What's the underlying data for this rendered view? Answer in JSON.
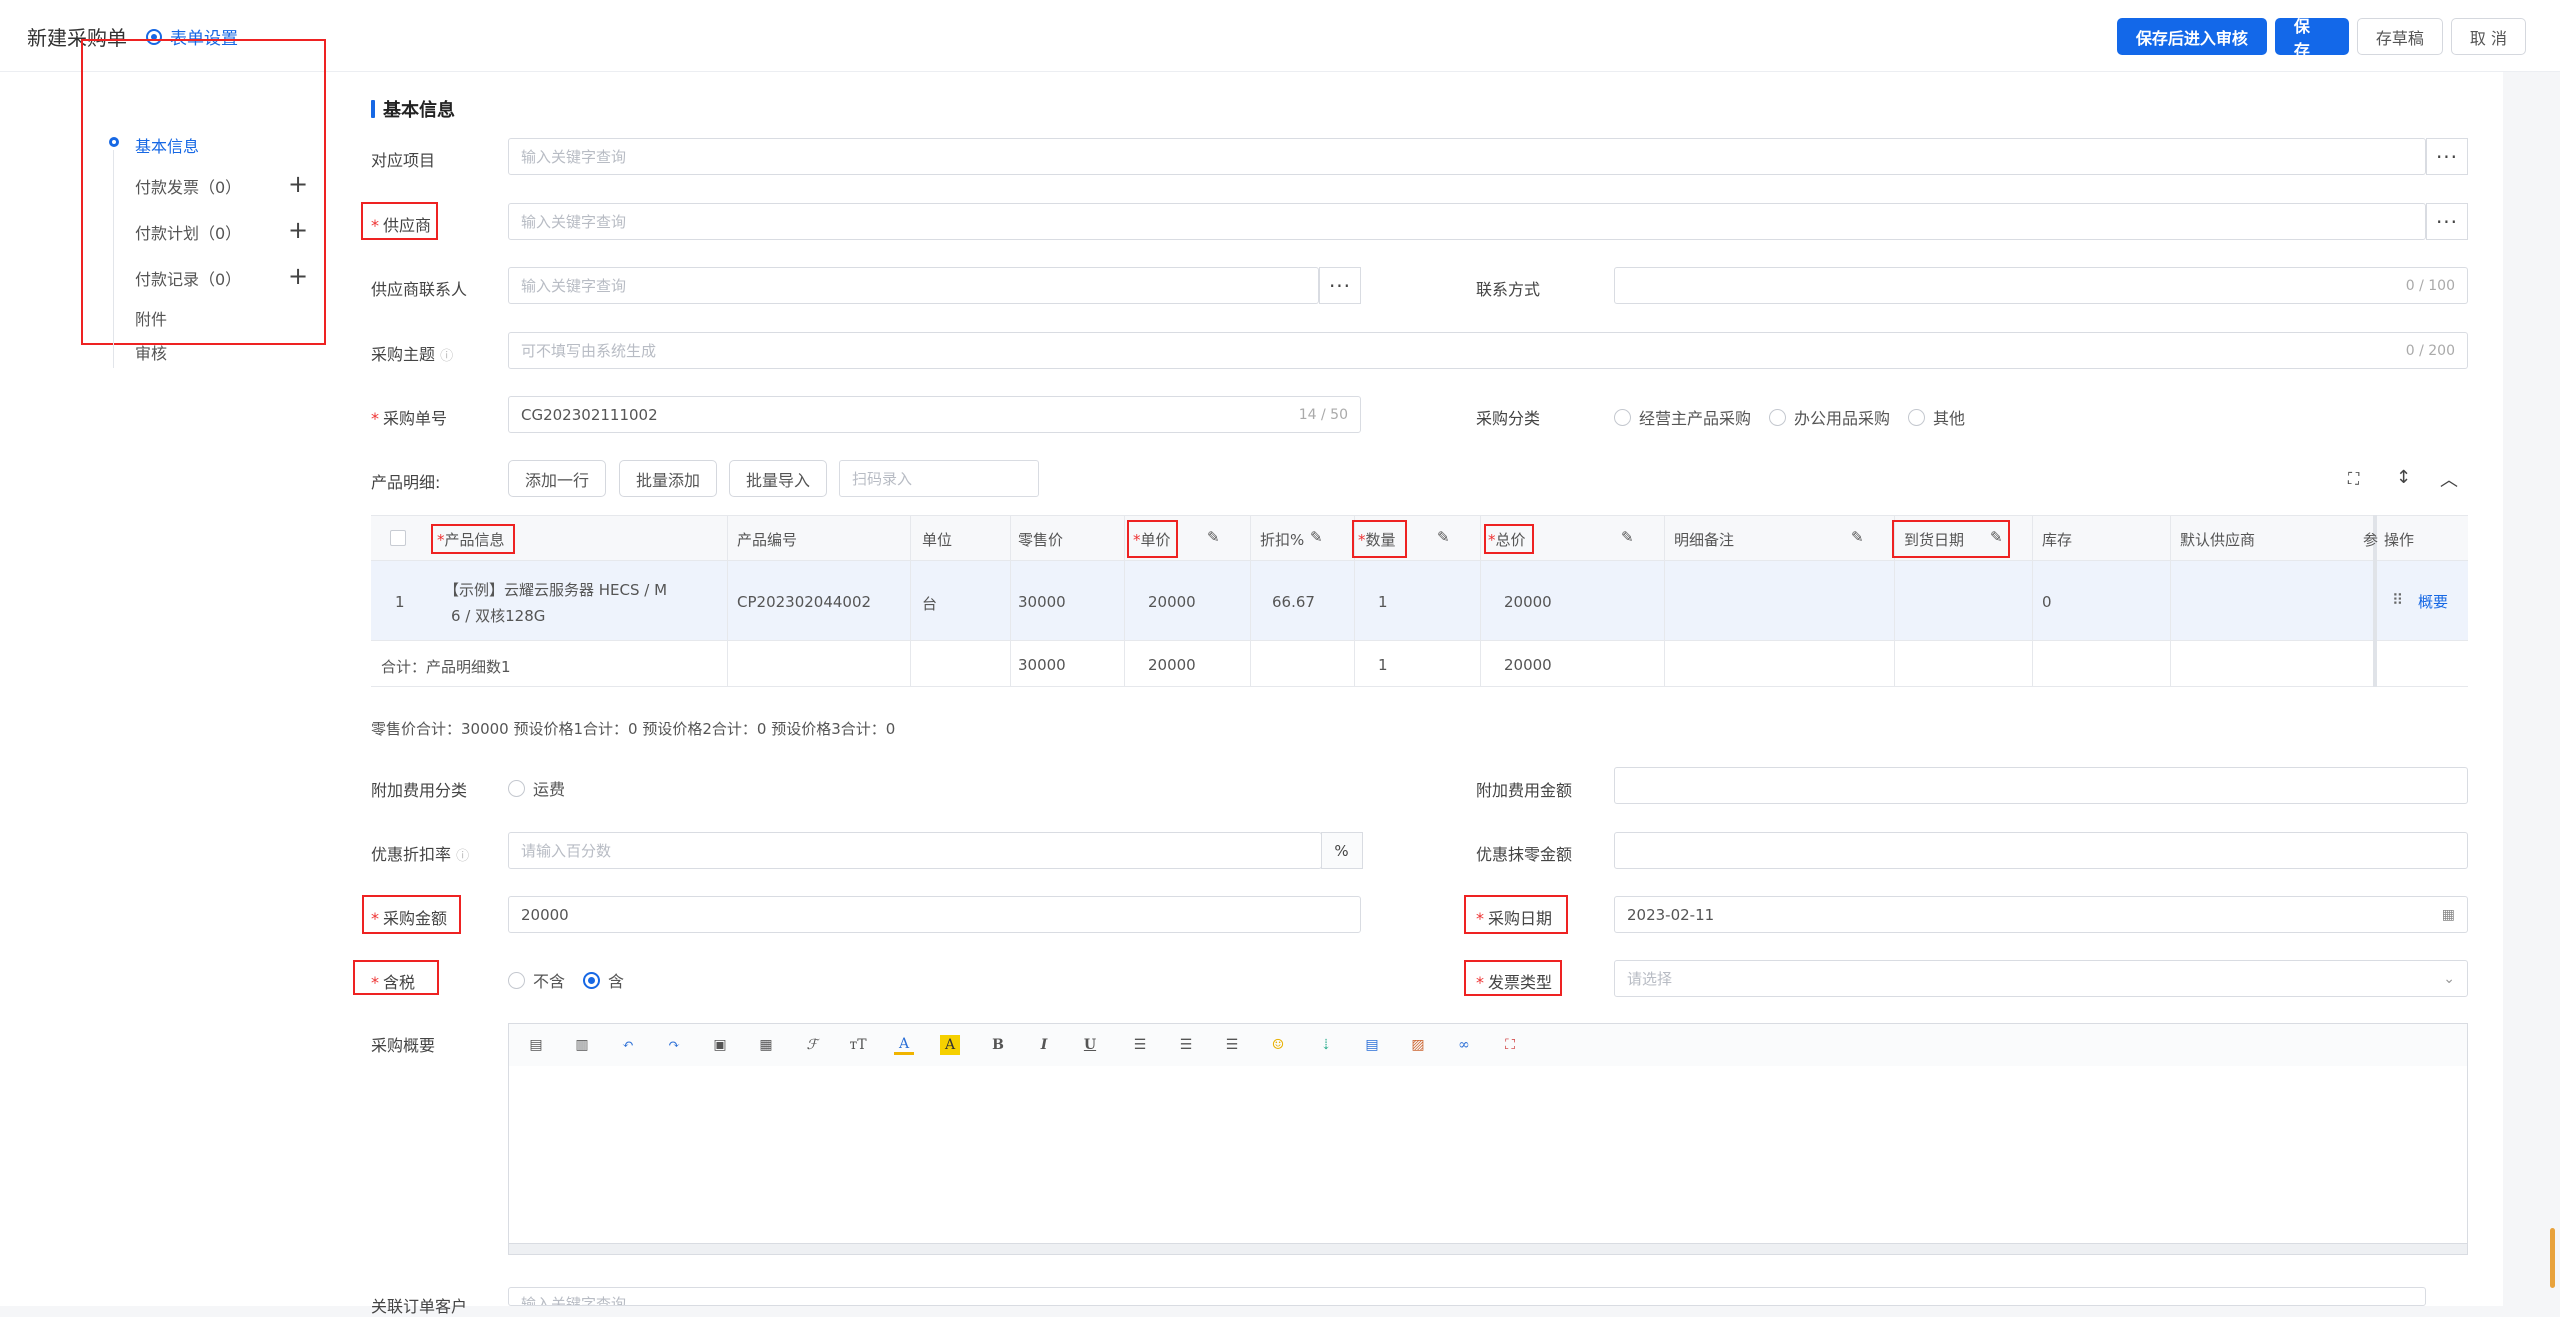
{
  "header": {
    "title": "新建采购单",
    "form_settings": "表单设置",
    "buttons": {
      "save_submit": "保存后进入审核",
      "save": "保 存",
      "draft": "存草稿",
      "cancel": "取 消"
    }
  },
  "nav": {
    "items": [
      {
        "label": "基本信息",
        "active": true
      },
      {
        "label": "付款发票（0）"
      },
      {
        "label": "付款计划（0）"
      },
      {
        "label": "付款记录（0）"
      },
      {
        "label": "附件"
      },
      {
        "label": "审核"
      }
    ],
    "plus": "+"
  },
  "section": {
    "title": "基本信息"
  },
  "fields": {
    "project": {
      "label": "对应项目",
      "placeholder": "输入关键字查询"
    },
    "supplier": {
      "label": "供应商",
      "placeholder": "输入关键字查询"
    },
    "supplier_contact": {
      "label": "供应商联系人",
      "placeholder": "输入关键字查询"
    },
    "contact_method": {
      "label": "联系方式",
      "count": "0 / 100"
    },
    "subject": {
      "label": "采购主题",
      "placeholder": "可不填写由系统生成",
      "count": "0 / 200"
    },
    "order_no": {
      "label": "采购单号",
      "value": "CG202302111002",
      "count": "14 / 50"
    },
    "category": {
      "label": "采购分类",
      "options": [
        "经营主产品采购",
        "办公用品采购",
        "其他"
      ]
    },
    "products_label": "产品明细:",
    "product_buttons": {
      "add_row": "添加一行",
      "batch_add": "批量添加",
      "batch_import": "批量导入"
    },
    "scan_placeholder": "扫码录入",
    "extra_fee_type": {
      "label": "附加费用分类",
      "option": "运费"
    },
    "extra_fee_amount": {
      "label": "附加费用金额"
    },
    "discount_rate": {
      "label": "优惠折扣率",
      "placeholder": "请输入百分数",
      "suffix": "%"
    },
    "round_off": {
      "label": "优惠抹零金额"
    },
    "amount": {
      "label": "采购金额",
      "value": "20000"
    },
    "date": {
      "label": "采购日期",
      "value": "2023-02-11"
    },
    "tax": {
      "label": "含税",
      "options": [
        "不含",
        "含"
      ],
      "selected": "含"
    },
    "invoice_type": {
      "label": "发票类型",
      "placeholder": "请选择"
    },
    "summary": {
      "label": "采购概要"
    },
    "related": {
      "label": "关联订单客户",
      "placeholder": "输入关键字查询"
    }
  },
  "table": {
    "headers": {
      "product_info": "产品信息",
      "product_code": "产品编号",
      "unit": "单位",
      "retail": "零售价",
      "price": "单价",
      "discount": "折扣%",
      "qty": "数量",
      "total": "总价",
      "remark": "明细备注",
      "arrival": "到货日期",
      "stock": "库存",
      "default_supplier": "默认供应商",
      "extra": "参",
      "ops": "操作"
    },
    "row": {
      "index": "1",
      "product_info_1": "【示例】云耀云服务器 HECS / M",
      "product_info_2": "6 / 双核128G",
      "product_code": "CP202302044002",
      "unit": "台",
      "retail": "30000",
      "price": "20000",
      "discount": "66.67",
      "qty": "1",
      "total": "20000",
      "stock": "0",
      "op": "概要"
    },
    "sum_row": {
      "label": "合计：产品明细数1",
      "retail": "30000",
      "price": "20000",
      "qty": "1",
      "total": "20000"
    },
    "totals_line": "零售价合计：30000  预设价格1合计：0  预设价格2合计：0  预设价格3合计：0"
  },
  "colors": {
    "primary": "#1368e9",
    "required": "#e33",
    "highlight_box": "#e22"
  }
}
